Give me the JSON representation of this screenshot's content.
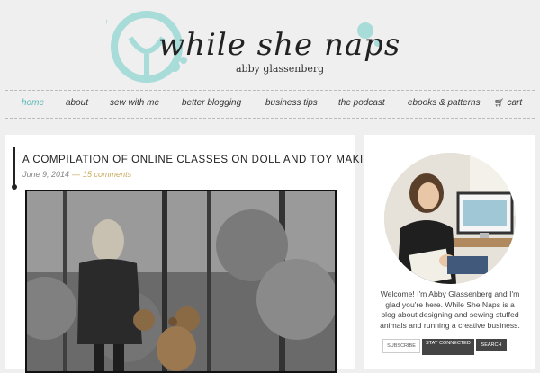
{
  "header": {
    "site_title": "while she naps",
    "tagline": "abby glassenberg"
  },
  "nav": {
    "items": [
      {
        "label": "home"
      },
      {
        "label": "about"
      },
      {
        "label": "sew with me"
      },
      {
        "label": "better blogging"
      },
      {
        "label": "business tips"
      },
      {
        "label": "the podcast"
      },
      {
        "label": "ebooks & patterns"
      },
      {
        "label": "cart"
      }
    ],
    "active": "home",
    "accent_color": "#5bb6b4",
    "cart_icon": "cart-icon"
  },
  "post": {
    "title": "A COMPILATION OF ONLINE CLASSES ON DOLL AND TOY MAKING",
    "date": "June 9, 2014",
    "separator": "—",
    "comments": "15 comments"
  },
  "sidebar": {
    "intro": "Welcome! I'm Abby Glassenberg and I'm glad you're here. While She Naps is a blog about designing and sewing stuffed animals and running a creative business.",
    "subscribe_label": "SUBSCRIBE",
    "stay_connected_label": "STAY CONNECTED",
    "search_label": "SEARCH"
  }
}
